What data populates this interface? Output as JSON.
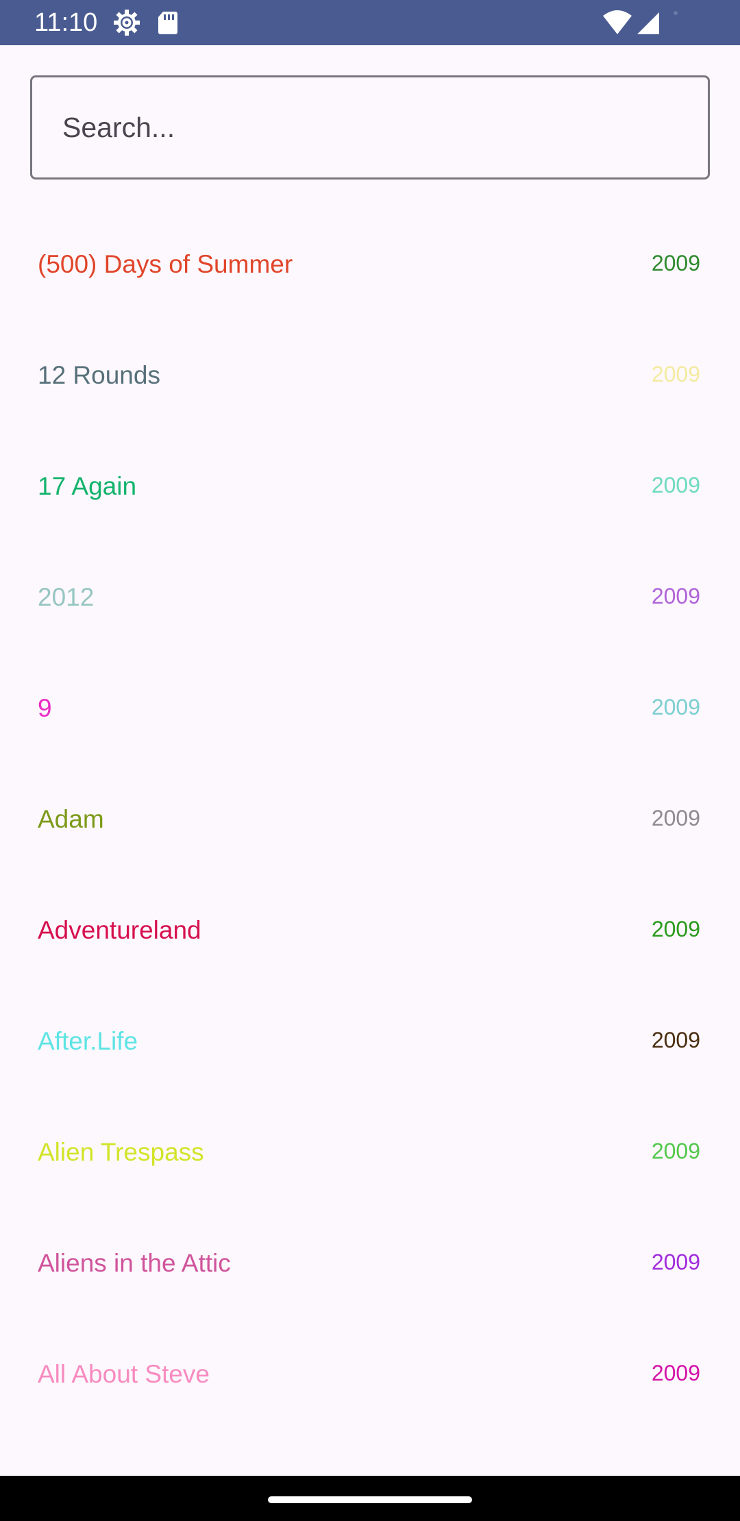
{
  "status_bar": {
    "time": "11:10",
    "icons": [
      "settings-gear-icon",
      "sd-card-icon",
      "wifi-icon",
      "cellular-signal-icon"
    ],
    "background": "#4a5b91"
  },
  "search": {
    "placeholder": "Search...",
    "value": ""
  },
  "movies": [
    {
      "title": "(500) Days of Summer",
      "year": "2009",
      "title_color": "#e0452a",
      "year_color": "#2e8b2e"
    },
    {
      "title": "12 Rounds",
      "year": "2009",
      "title_color": "#56707a",
      "year_color": "#f3eba0"
    },
    {
      "title": "17 Again",
      "year": "2009",
      "title_color": "#12b36c",
      "year_color": "#6ddbc0"
    },
    {
      "title": "2012",
      "year": "2009",
      "title_color": "#97c6c2",
      "year_color": "#b064d8"
    },
    {
      "title": "9",
      "year": "2009",
      "title_color": "#ec2cc6",
      "year_color": "#7ccfd0"
    },
    {
      "title": "Adam",
      "year": "2009",
      "title_color": "#7c9a18",
      "year_color": "#8e8a90"
    },
    {
      "title": "Adventureland",
      "year": "2009",
      "title_color": "#d6104e",
      "year_color": "#2a9a1e"
    },
    {
      "title": "After.Life",
      "year": "2009",
      "title_color": "#5ee4e4",
      "year_color": "#4a2e10"
    },
    {
      "title": "Alien Trespass",
      "year": "2009",
      "title_color": "#d2e42a",
      "year_color": "#52c84a"
    },
    {
      "title": "Aliens in the Attic",
      "year": "2009",
      "title_color": "#d0549c",
      "year_color": "#a02cdc"
    },
    {
      "title": "All About Steve",
      "year": "2009",
      "title_color": "#f78bc0",
      "year_color": "#d414a8"
    }
  ]
}
